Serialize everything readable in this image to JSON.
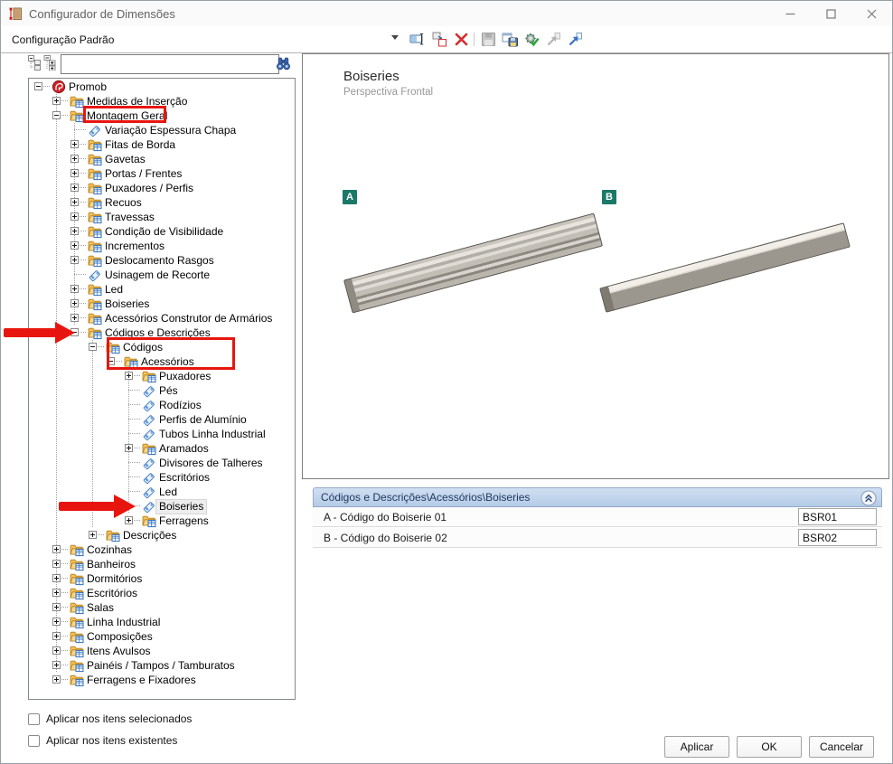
{
  "window": {
    "title": "Configurador de Dimensões"
  },
  "toolbar": {
    "config_selector_value": "Configuração Padrão",
    "icons": [
      {
        "name": "rename-config-icon",
        "enabled": true
      },
      {
        "name": "duplicate-config-icon",
        "enabled": true
      },
      {
        "name": "delete-config-icon",
        "enabled": true
      },
      {
        "name": "save-config-icon",
        "enabled": false
      },
      {
        "name": "save-config-as-icon",
        "enabled": true
      },
      {
        "name": "apply-config-icon",
        "enabled": true
      },
      {
        "name": "import-config-icon",
        "enabled": false
      },
      {
        "name": "export-config-icon",
        "enabled": true
      }
    ]
  },
  "search": {
    "value": "",
    "placeholder": ""
  },
  "tree": {
    "items": [
      {
        "label": "Promob",
        "depth": 0,
        "icon": "promob",
        "toggle": "minus"
      },
      {
        "label": "Medidas de Inserção",
        "depth": 1,
        "icon": "folder",
        "toggle": "plus"
      },
      {
        "label": "Montagem Geral",
        "depth": 1,
        "icon": "folder",
        "toggle": "minus",
        "red_box": true
      },
      {
        "label": "Variação Espessura Chapa",
        "depth": 2,
        "icon": "tag",
        "toggle": null
      },
      {
        "label": "Fitas de Borda",
        "depth": 2,
        "icon": "folder",
        "toggle": "plus"
      },
      {
        "label": "Gavetas",
        "depth": 2,
        "icon": "folder",
        "toggle": "plus"
      },
      {
        "label": "Portas / Frentes",
        "depth": 2,
        "icon": "folder",
        "toggle": "plus"
      },
      {
        "label": "Puxadores / Perfis",
        "depth": 2,
        "icon": "folder",
        "toggle": "plus"
      },
      {
        "label": "Recuos",
        "depth": 2,
        "icon": "folder",
        "toggle": "plus"
      },
      {
        "label": "Travessas",
        "depth": 2,
        "icon": "folder",
        "toggle": "plus"
      },
      {
        "label": "Condição de Visibilidade",
        "depth": 2,
        "icon": "folder",
        "toggle": "plus"
      },
      {
        "label": "Incrementos",
        "depth": 2,
        "icon": "folder",
        "toggle": "plus"
      },
      {
        "label": "Deslocamento Rasgos",
        "depth": 2,
        "icon": "folder",
        "toggle": "plus"
      },
      {
        "label": "Usinagem de Recorte",
        "depth": 2,
        "icon": "tag",
        "toggle": null
      },
      {
        "label": "Led",
        "depth": 2,
        "icon": "folder",
        "toggle": "plus"
      },
      {
        "label": "Boiseries",
        "depth": 2,
        "icon": "folder",
        "toggle": "plus"
      },
      {
        "label": "Acessórios Construtor de Armários",
        "depth": 2,
        "icon": "folder",
        "toggle": "plus"
      },
      {
        "label": "Códigos e Descrições",
        "depth": 2,
        "icon": "folder",
        "toggle": "minus",
        "red_arrow": true
      },
      {
        "label": "Códigos",
        "depth": 3,
        "icon": "folder",
        "toggle": "minus",
        "red_box": true
      },
      {
        "label": "Acessórios",
        "depth": 4,
        "icon": "folder",
        "toggle": "minus",
        "red_box": true
      },
      {
        "label": "Puxadores",
        "depth": 5,
        "icon": "folder",
        "toggle": "plus"
      },
      {
        "label": "Pés",
        "depth": 5,
        "icon": "tag",
        "toggle": null
      },
      {
        "label": "Rodízios",
        "depth": 5,
        "icon": "tag",
        "toggle": null
      },
      {
        "label": "Perfis de Alumínio",
        "depth": 5,
        "icon": "tag",
        "toggle": null
      },
      {
        "label": "Tubos Linha Industrial",
        "depth": 5,
        "icon": "tag",
        "toggle": null
      },
      {
        "label": "Aramados",
        "depth": 5,
        "icon": "folder",
        "toggle": "plus"
      },
      {
        "label": "Divisores de Talheres",
        "depth": 5,
        "icon": "tag",
        "toggle": null
      },
      {
        "label": "Escritórios",
        "depth": 5,
        "icon": "tag",
        "toggle": null
      },
      {
        "label": "Led",
        "depth": 5,
        "icon": "tag",
        "toggle": null
      },
      {
        "label": "Boiseries",
        "depth": 5,
        "icon": "tag",
        "toggle": null,
        "selected": true,
        "red_arrow": true
      },
      {
        "label": "Ferragens",
        "depth": 5,
        "icon": "folder",
        "toggle": "plus"
      },
      {
        "label": "Descrições",
        "depth": 3,
        "icon": "folder",
        "toggle": "plus"
      },
      {
        "label": "Cozinhas",
        "depth": 1,
        "icon": "folder",
        "toggle": "plus"
      },
      {
        "label": "Banheiros",
        "depth": 1,
        "icon": "folder",
        "toggle": "plus"
      },
      {
        "label": "Dormitórios",
        "depth": 1,
        "icon": "folder",
        "toggle": "plus"
      },
      {
        "label": "Escritórios",
        "depth": 1,
        "icon": "folder",
        "toggle": "plus"
      },
      {
        "label": "Salas",
        "depth": 1,
        "icon": "folder",
        "toggle": "plus"
      },
      {
        "label": "Linha Industrial",
        "depth": 1,
        "icon": "folder",
        "toggle": "plus"
      },
      {
        "label": "Composições",
        "depth": 1,
        "icon": "folder",
        "toggle": "plus"
      },
      {
        "label": "Itens Avulsos",
        "depth": 1,
        "icon": "folder",
        "toggle": "plus"
      },
      {
        "label": "Painéis / Tampos / Tamburatos",
        "depth": 1,
        "icon": "folder",
        "toggle": "plus"
      },
      {
        "label": "Ferragens e Fixadores",
        "depth": 1,
        "icon": "folder",
        "toggle": "plus"
      }
    ]
  },
  "preview": {
    "title": "Boiseries",
    "subtitle": "Perspectiva Frontal",
    "badge_a": "A",
    "badge_b": "B"
  },
  "codes_panel": {
    "header": "Códigos e Descrições\\Acessórios\\Boiseries",
    "rows": [
      {
        "label": "A - Código do Boiserie 01",
        "value": "BSR01"
      },
      {
        "label": "B - Código do Boiserie 02",
        "value": "BSR02"
      }
    ]
  },
  "footer": {
    "checkboxes": [
      {
        "label": "Aplicar nos itens selecionados",
        "checked": false
      },
      {
        "label": "Aplicar nos itens existentes",
        "checked": false
      }
    ],
    "buttons": [
      {
        "label": "Aplicar"
      },
      {
        "label": "OK"
      },
      {
        "label": "Cancelar"
      }
    ]
  },
  "colors": {
    "annotation_red": "#e8150f",
    "badge_teal": "#1b7a67",
    "table_header_blue": "#b4cbe6"
  }
}
